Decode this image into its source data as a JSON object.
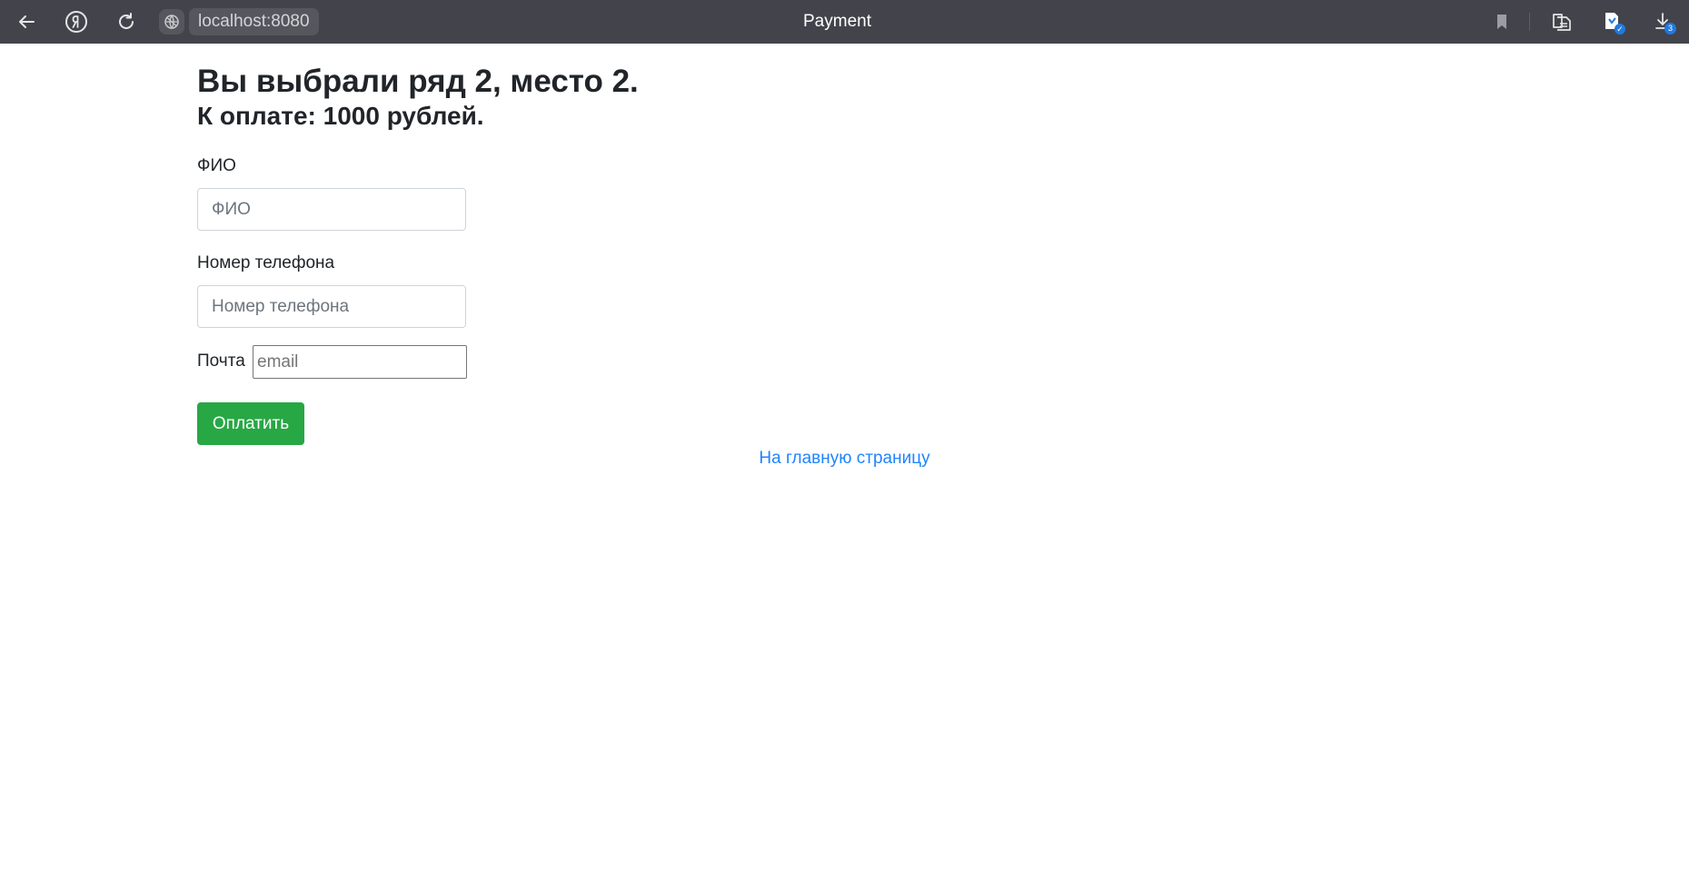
{
  "browser": {
    "address": "localhost:8080",
    "tab_title": "Payment",
    "downloads_count": "3",
    "icons": [
      "back-arrow-icon",
      "yandex-icon",
      "reload-icon",
      "site-info-icon",
      "bookmark-icon",
      "reader-mode-icon",
      "extension-icon",
      "downloads-icon"
    ]
  },
  "page": {
    "heading": "Вы выбрали ряд 2, место 2.",
    "subheading": "К оплате: 1000 рублей.",
    "form": {
      "name_label": "ФИО",
      "name_placeholder": "ФИО",
      "phone_label": "Номер телефона",
      "phone_placeholder": "Номер телефона",
      "email_label": "Почта",
      "email_placeholder": "email",
      "submit_label": "Оплатить"
    },
    "home_link": "На главную страницу"
  },
  "colors": {
    "toolbar_bg": "#43434b",
    "button_green": "#28a745",
    "link_blue": "#1f84ff",
    "text": "#212529"
  }
}
